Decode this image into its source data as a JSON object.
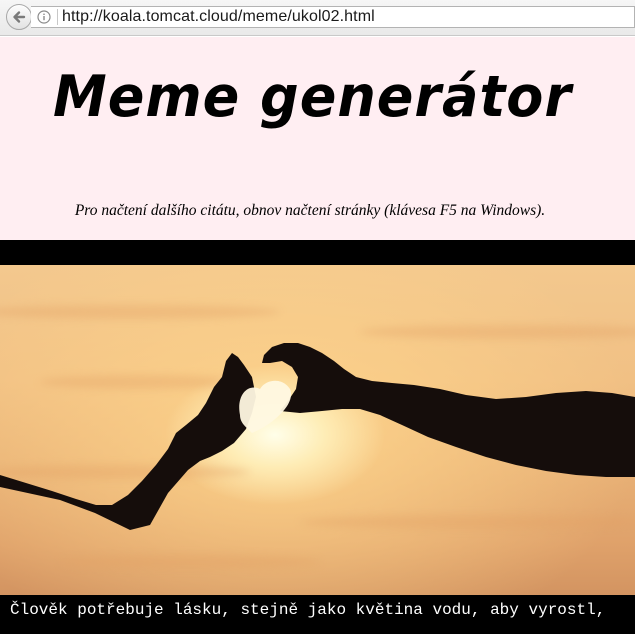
{
  "browser": {
    "url": "http://koala.tomcat.cloud/meme/ukol02.html",
    "back_icon": "arrow-left-icon",
    "info_icon": "info-icon"
  },
  "page": {
    "title": "Meme generátor",
    "subtitle": "Pro načtení dalšího citátu, obnov načtení stránky (klávesa F5 na Windows).",
    "background_color": "#ffeef2"
  },
  "meme": {
    "image": "silhouette-hands-heart-sunset",
    "caption": "Člověk potřebuje lásku, stejně jako květina vodu, aby vyrostl,"
  }
}
